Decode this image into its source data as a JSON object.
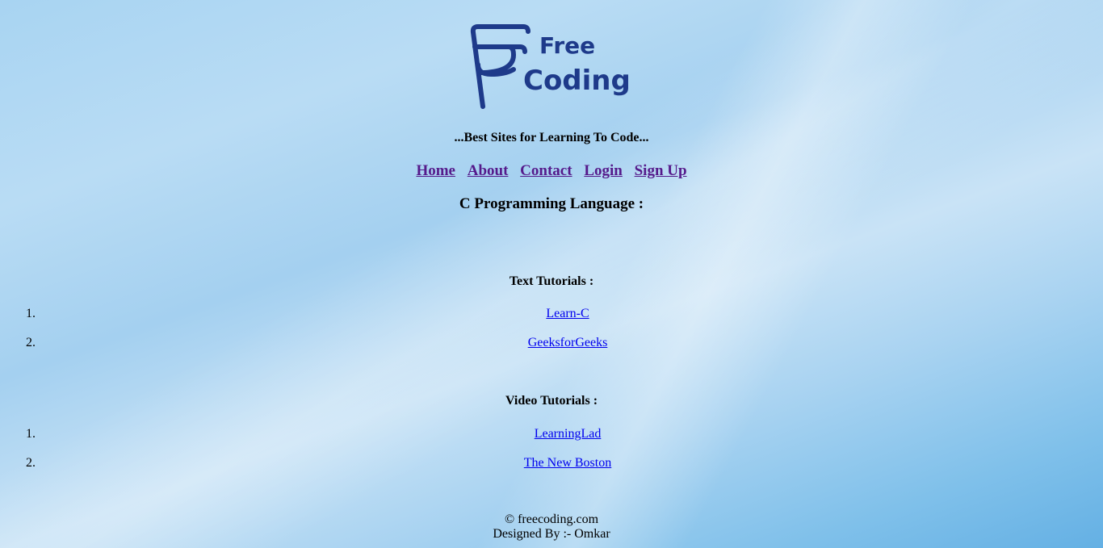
{
  "logo": {
    "line1": "Free",
    "line2": "Coding",
    "color": "#1e3a8a"
  },
  "tagline": "...Best Sites for Learning To Code...",
  "nav": [
    {
      "label": "Home"
    },
    {
      "label": "About"
    },
    {
      "label": "Contact"
    },
    {
      "label": "Login"
    },
    {
      "label": "Sign Up"
    }
  ],
  "page_heading": "C Programming Language :",
  "text_tutorials": {
    "title": "Text Tutorials :",
    "items": [
      {
        "num": "1.",
        "label": "Learn-C"
      },
      {
        "num": "2.",
        "label": "GeeksforGeeks"
      }
    ]
  },
  "video_tutorials": {
    "title": "Video Tutorials :",
    "items": [
      {
        "num": "1.",
        "label": "LearningLad"
      },
      {
        "num": "2.",
        "label": "The New Boston"
      }
    ]
  },
  "footer": {
    "copyright": "© freecoding.com",
    "designer": "Designed By :- Omkar"
  },
  "colors": {
    "visited_link": "#551a8b",
    "link": "#0000ee",
    "logo": "#1e3a8a"
  }
}
